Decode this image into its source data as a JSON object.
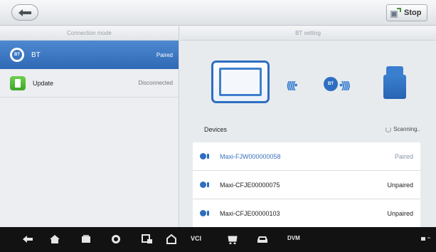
{
  "toolbar": {
    "back_icon": "back-arrow-icon",
    "stop_label": "Stop"
  },
  "left_panel": {
    "header": "Connection mode",
    "items": [
      {
        "name": "BT",
        "status": "Paired",
        "icon": "bluetooth-icon",
        "selected": true
      },
      {
        "name": "Update",
        "status": "Disconnected",
        "icon": "update-icon",
        "selected": false
      }
    ]
  },
  "right_panel": {
    "header": "BT setting",
    "illustration": {
      "left": "tablet-icon",
      "center": "bluetooth-icon",
      "right": "vci-icon"
    },
    "devices_label": "Devices",
    "scanning_label": "Scanning..",
    "devices": [
      {
        "name": "Maxi-FJW000000058",
        "status": "Paired"
      },
      {
        "name": "Maxi-CFJE00000075",
        "status": "Unpaired"
      },
      {
        "name": "Maxi-CFJE00000103",
        "status": "Unpaired"
      }
    ]
  },
  "bottom_nav": {
    "items": [
      "back-icon",
      "home-icon",
      "recent-apps-icon",
      "browser-icon",
      "screenshot-icon",
      "maxisys-home-icon",
      "VCI",
      "shop-icon",
      "car-icon",
      "dvm-icon"
    ],
    "vci_label": "VCI",
    "dvm_label": "DVM"
  },
  "colors": {
    "accent": "#2e6ec0",
    "selected_row": "#3a76c2",
    "navbar": "#121212"
  }
}
